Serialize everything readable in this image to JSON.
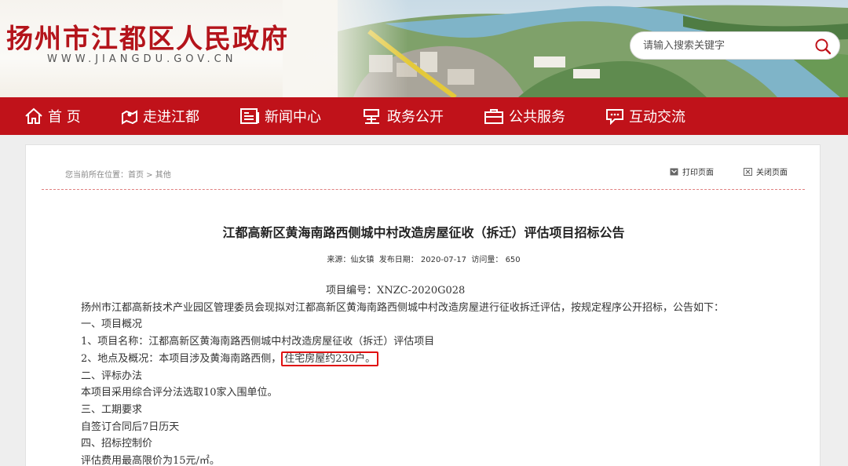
{
  "header": {
    "site_title": "扬州市江都区人民政府",
    "site_domain": "WWW.JIANGDU.GOV.CN",
    "search_placeholder": "请输入搜索关键字",
    "brand_color": "#c0121a"
  },
  "nav": {
    "items": [
      {
        "label": "首 页",
        "icon": "home-icon"
      },
      {
        "label": "走进江都",
        "icon": "location-icon"
      },
      {
        "label": "新闻中心",
        "icon": "newspaper-icon"
      },
      {
        "label": "政务公开",
        "icon": "government-icon"
      },
      {
        "label": "公共服务",
        "icon": "briefcase-icon"
      },
      {
        "label": "互动交流",
        "icon": "chat-icon"
      }
    ]
  },
  "breadcrumb": {
    "prefix": "您当前所在位置：",
    "home": "首页",
    "separator": " > ",
    "current": "其他"
  },
  "tools": {
    "print_label": "打印页面",
    "close_label": "关闭页面"
  },
  "article": {
    "title": "江都高新区黄海南路西侧城中村改造房屋征收（拆迁）评估项目招标公告",
    "meta": {
      "source": "来源：仙女镇",
      "date_label": "发布日期：",
      "date": "2020-07-17",
      "views_label": "访问量：",
      "views": "650"
    },
    "code_line": "项目编号：XNZC-2020G028",
    "intro": "扬州市江都高新技术产业园区管理委员会现拟对江都高新区黄海南路西侧城中村改造房屋进行征收拆迁评估，按规定程序公开招标，公告如下：",
    "section1": "一、项目概况",
    "item1": "1、项目名称：江都高新区黄海南路西侧城中村改造房屋征收（拆迁）评估项目",
    "item2_pre": "2、地点及概况：本项目涉及黄海南路西侧，",
    "item2_highlight": "住宅房屋约230户。",
    "section2": "二、评标办法",
    "method": "本项目采用综合评分法选取10家入围单位。",
    "section3": "三、工期要求",
    "period": "自签订合同后7日历天",
    "section4": "四、招标控制价",
    "price": "评估费用最高限价为15元/㎡。"
  }
}
